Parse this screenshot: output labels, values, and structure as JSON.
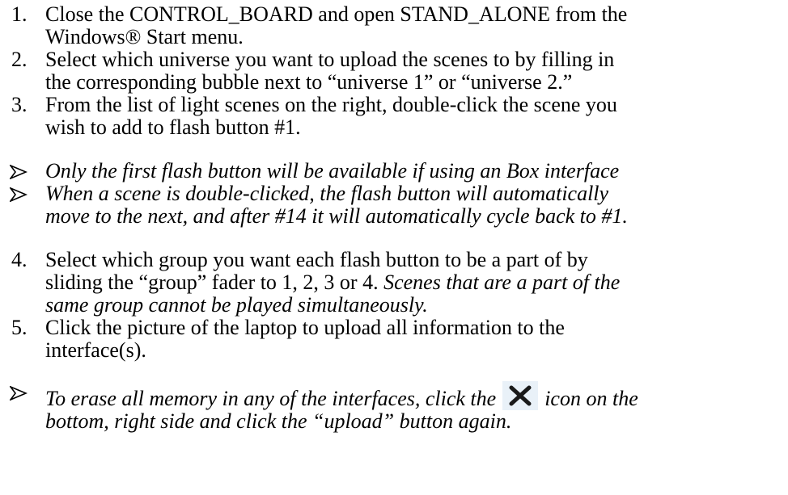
{
  "steps": [
    {
      "number": "1.",
      "lines": [
        "Close the CONTROL_BOARD and open STAND_ALONE from the",
        "Windows® Start menu."
      ]
    },
    {
      "number": "2.",
      "lines": [
        "Select which universe you want to upload the scenes to by filling in",
        "the corresponding bubble next to “universe 1” or “universe 2.”"
      ]
    },
    {
      "number": "3.",
      "lines": [
        "From the list of light scenes on the right, double-click the scene you",
        "wish to add to flash button #1."
      ]
    }
  ],
  "notes_a": [
    {
      "lines": [
        "Only the first flash button will be available if using an Box interface"
      ]
    },
    {
      "lines": [
        "When a scene is double-clicked, the flash button will automatically",
        "move to the next, and after #14 it will automatically cycle back to #1."
      ]
    }
  ],
  "step4": {
    "number": "4.",
    "line1": "Select which group you want each flash button to be a part of by",
    "line2_plain": "sliding the “group” fader to 1, 2, 3 or 4. ",
    "line2_italic": "Scenes that are a part of the",
    "line3_italic": "same group cannot be played simultaneously."
  },
  "step5": {
    "number": "5.",
    "lines": [
      "Click the picture of the laptop to upload all information to the",
      "interface(s)."
    ]
  },
  "note_erase": {
    "before_icon": "To erase all memory in any of the interfaces, click the",
    "after_icon": "icon on the",
    "line2": "bottom, right side and click the “upload” button again.",
    "icon": "close-x-icon"
  },
  "colors": {
    "text": "#000000",
    "icon_background": "#e9f1f8",
    "icon_glyph": "#1a1a1a"
  }
}
